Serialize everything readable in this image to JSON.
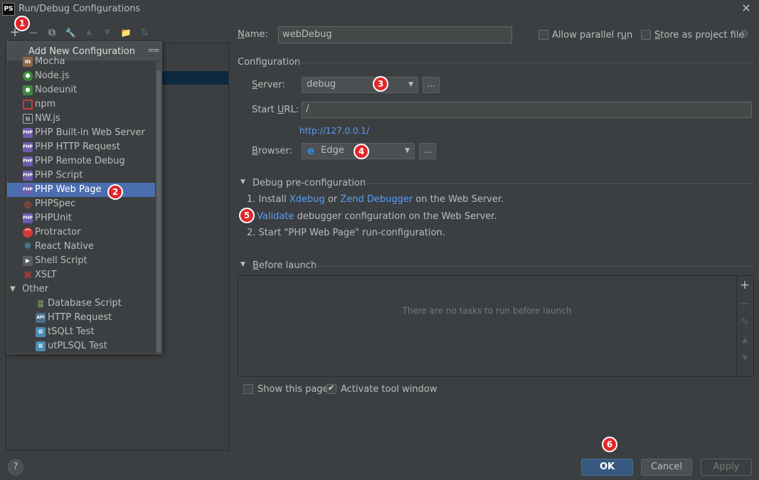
{
  "window": {
    "app_icon_text": "PS",
    "title": "Run/Debug Configurations",
    "close": "✕"
  },
  "toolbar": {
    "add": "+",
    "remove": "—",
    "copy": "⧉",
    "wrench": "🔧",
    "up": "▲",
    "down": "▼",
    "folder": "📁",
    "sort": "⇅"
  },
  "popup": {
    "title": "Add New Configuration",
    "items": [
      {
        "label": "Mocha"
      },
      {
        "label": "Node.js"
      },
      {
        "label": "Nodeunit"
      },
      {
        "label": "npm"
      },
      {
        "label": "NW.js"
      },
      {
        "label": "PHP Built-in Web Server"
      },
      {
        "label": "PHP HTTP Request"
      },
      {
        "label": "PHP Remote Debug"
      },
      {
        "label": "PHP Script"
      },
      {
        "label": "PHP Web Page"
      },
      {
        "label": "PHPSpec"
      },
      {
        "label": "PHPUnit"
      },
      {
        "label": "Protractor"
      },
      {
        "label": "React Native"
      },
      {
        "label": "Shell Script"
      },
      {
        "label": "XSLT"
      },
      {
        "label": "Other"
      },
      {
        "label": "Database Script"
      },
      {
        "label": "HTTP Request"
      },
      {
        "label": "tSQLt Test"
      },
      {
        "label": "utPLSQL Test"
      }
    ]
  },
  "form": {
    "name_label_u": "N",
    "name_label_rest": "ame:",
    "name_value": "webDebug",
    "allow_parallel_label": "Allow parallel r",
    "allow_parallel_u": "u",
    "allow_parallel_rest": "n",
    "store_project_label_u": "S",
    "store_project_label_rest": "tore as project file",
    "configuration_title": "Configuration",
    "server_label_u": "S",
    "server_label_rest": "erver:",
    "server_value": "debug",
    "start_url_label_a": "Start ",
    "start_url_label_u": "U",
    "start_url_label_rest": "RL:",
    "start_url_value": "/",
    "url_link": "http://127.0.0.1/",
    "browser_label_u": "B",
    "browser_label_rest": "rowser:",
    "browser_value": "Edge",
    "ellipsis": "..."
  },
  "debug_pre": {
    "title": "Debug pre-configuration",
    "step1_prefix": "1. Install ",
    "step1_link1": "Xdebug",
    "step1_or": " or ",
    "step1_link2": "Zend Debugger",
    "step1_suffix": " on the Web Server.",
    "validate_link": "Validate",
    "validate_suffix": " debugger configuration on the Web Server.",
    "step2": "2. Start \"PHP Web Page\" run-configuration."
  },
  "before_launch": {
    "title_u": "B",
    "title_rest": "efore launch",
    "empty_text": "There are no tasks to run before launch"
  },
  "bottom": {
    "show_page": "Show this page",
    "activate_tool": "Activate tool window"
  },
  "buttons": {
    "ok": "OK",
    "cancel": "Cancel",
    "apply": "Apply",
    "help": "?"
  },
  "badges": [
    "1",
    "2",
    "3",
    "4",
    "5",
    "6"
  ],
  "colors": {
    "background": "#3c3f41",
    "selection": "#4b6eaf",
    "link": "#589df6",
    "ok_button": "#365880",
    "badge": "#e3262a"
  }
}
